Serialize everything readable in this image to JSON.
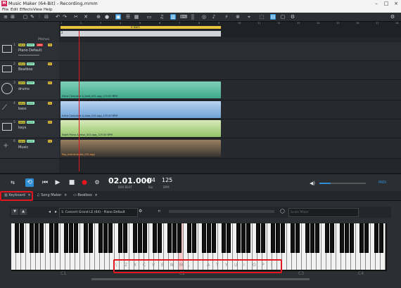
{
  "window": {
    "title": "Music Maker (64-Bit) - Recording.mmm",
    "app_icon": "M"
  },
  "menu": [
    "File",
    "Edit",
    "Effects",
    "View",
    "Help"
  ],
  "toolbar": {
    "icons": [
      "undo-icon",
      "redo-icon",
      "cut-icon",
      "copy-icon",
      "paste-icon",
      "delete-icon",
      "record-icon",
      "loop-icon",
      "mixer-icon",
      "folder-icon",
      "list-icon",
      "grid-icon",
      "note-icon",
      "piano-icon",
      "keyboard-icon",
      "midi-icon",
      "effects-icon",
      "tempo-icon",
      "cursor-icon",
      "link-icon",
      "screen-icon",
      "settings-icon",
      "gear-icon"
    ]
  },
  "ruler": {
    "region_label": "6 Bars",
    "bars": [
      "1",
      "2",
      "3",
      "4",
      "5",
      "6",
      "7",
      "8",
      "9",
      "10",
      "11",
      "12",
      "13",
      "14",
      "15",
      "16",
      "17",
      "18",
      "19"
    ],
    "marker": "2"
  },
  "tracks": [
    {
      "num": "1",
      "name": "Piano Default",
      "header": "Pitches",
      "badges": [
        "SOLO",
        "MUTE",
        "ARM",
        "FX"
      ],
      "color": "#c22"
    },
    {
      "num": "2",
      "name": "Beatbox",
      "badges": [
        "SOLO",
        "MUTE",
        "FX"
      ],
      "color": "#c22"
    },
    {
      "num": "3",
      "name": "drums",
      "badges": [
        "SOLO",
        "MUTE",
        "FX"
      ],
      "color": "#3b8"
    },
    {
      "num": "4",
      "name": "bass",
      "badges": [
        "SOLO",
        "MUTE",
        "FX"
      ],
      "color": "#48c"
    },
    {
      "num": "5",
      "name": "keys",
      "badges": [
        "SOLO",
        "MUTE",
        "FX"
      ],
      "color": "#8a5"
    },
    {
      "num": "6",
      "name": "Music",
      "badges": [
        "SOLO",
        "MUTE",
        "FX"
      ],
      "color": "#d80"
    }
  ],
  "clips": {
    "drums": "Extra Complete A_beat_001.ogg_125.00 BPM",
    "bass": "Extra Complete A_bass_001.ogg_125.00 BPM",
    "keys": "Night Piano A_keys_002.ogg_125.00 BPM",
    "music": "Pop_Instrumental_001.ogg"
  },
  "transport": {
    "position": "02.01.000",
    "position_sub": "BAR BEAT",
    "signature": "4/4",
    "signature_sub": "Bar",
    "bpm": "125",
    "bpm_sub": "BPM",
    "midi": "MIDI"
  },
  "tabs": [
    {
      "label": "Keyboard",
      "active": true
    },
    {
      "label": "Song Maker",
      "active": false
    },
    {
      "label": "Beatbox",
      "active": false
    }
  ],
  "keyboard": {
    "instrument": "1: Concert Grand LE (64) - Piano Default",
    "scale": "Scale Major",
    "octave_labels": [
      "C1",
      "C2",
      "C3",
      "C4"
    ],
    "key_letters": [
      "\\",
      "Z",
      "X",
      "C",
      "V",
      "B",
      "N",
      "M",
      ",",
      ".",
      "A",
      "T",
      "Y",
      "U",
      "I",
      "O",
      "P",
      "|"
    ]
  },
  "colors": {
    "accent": "#2e8fd6",
    "highlight": "#e0171f",
    "playhead": "#e0171f"
  }
}
